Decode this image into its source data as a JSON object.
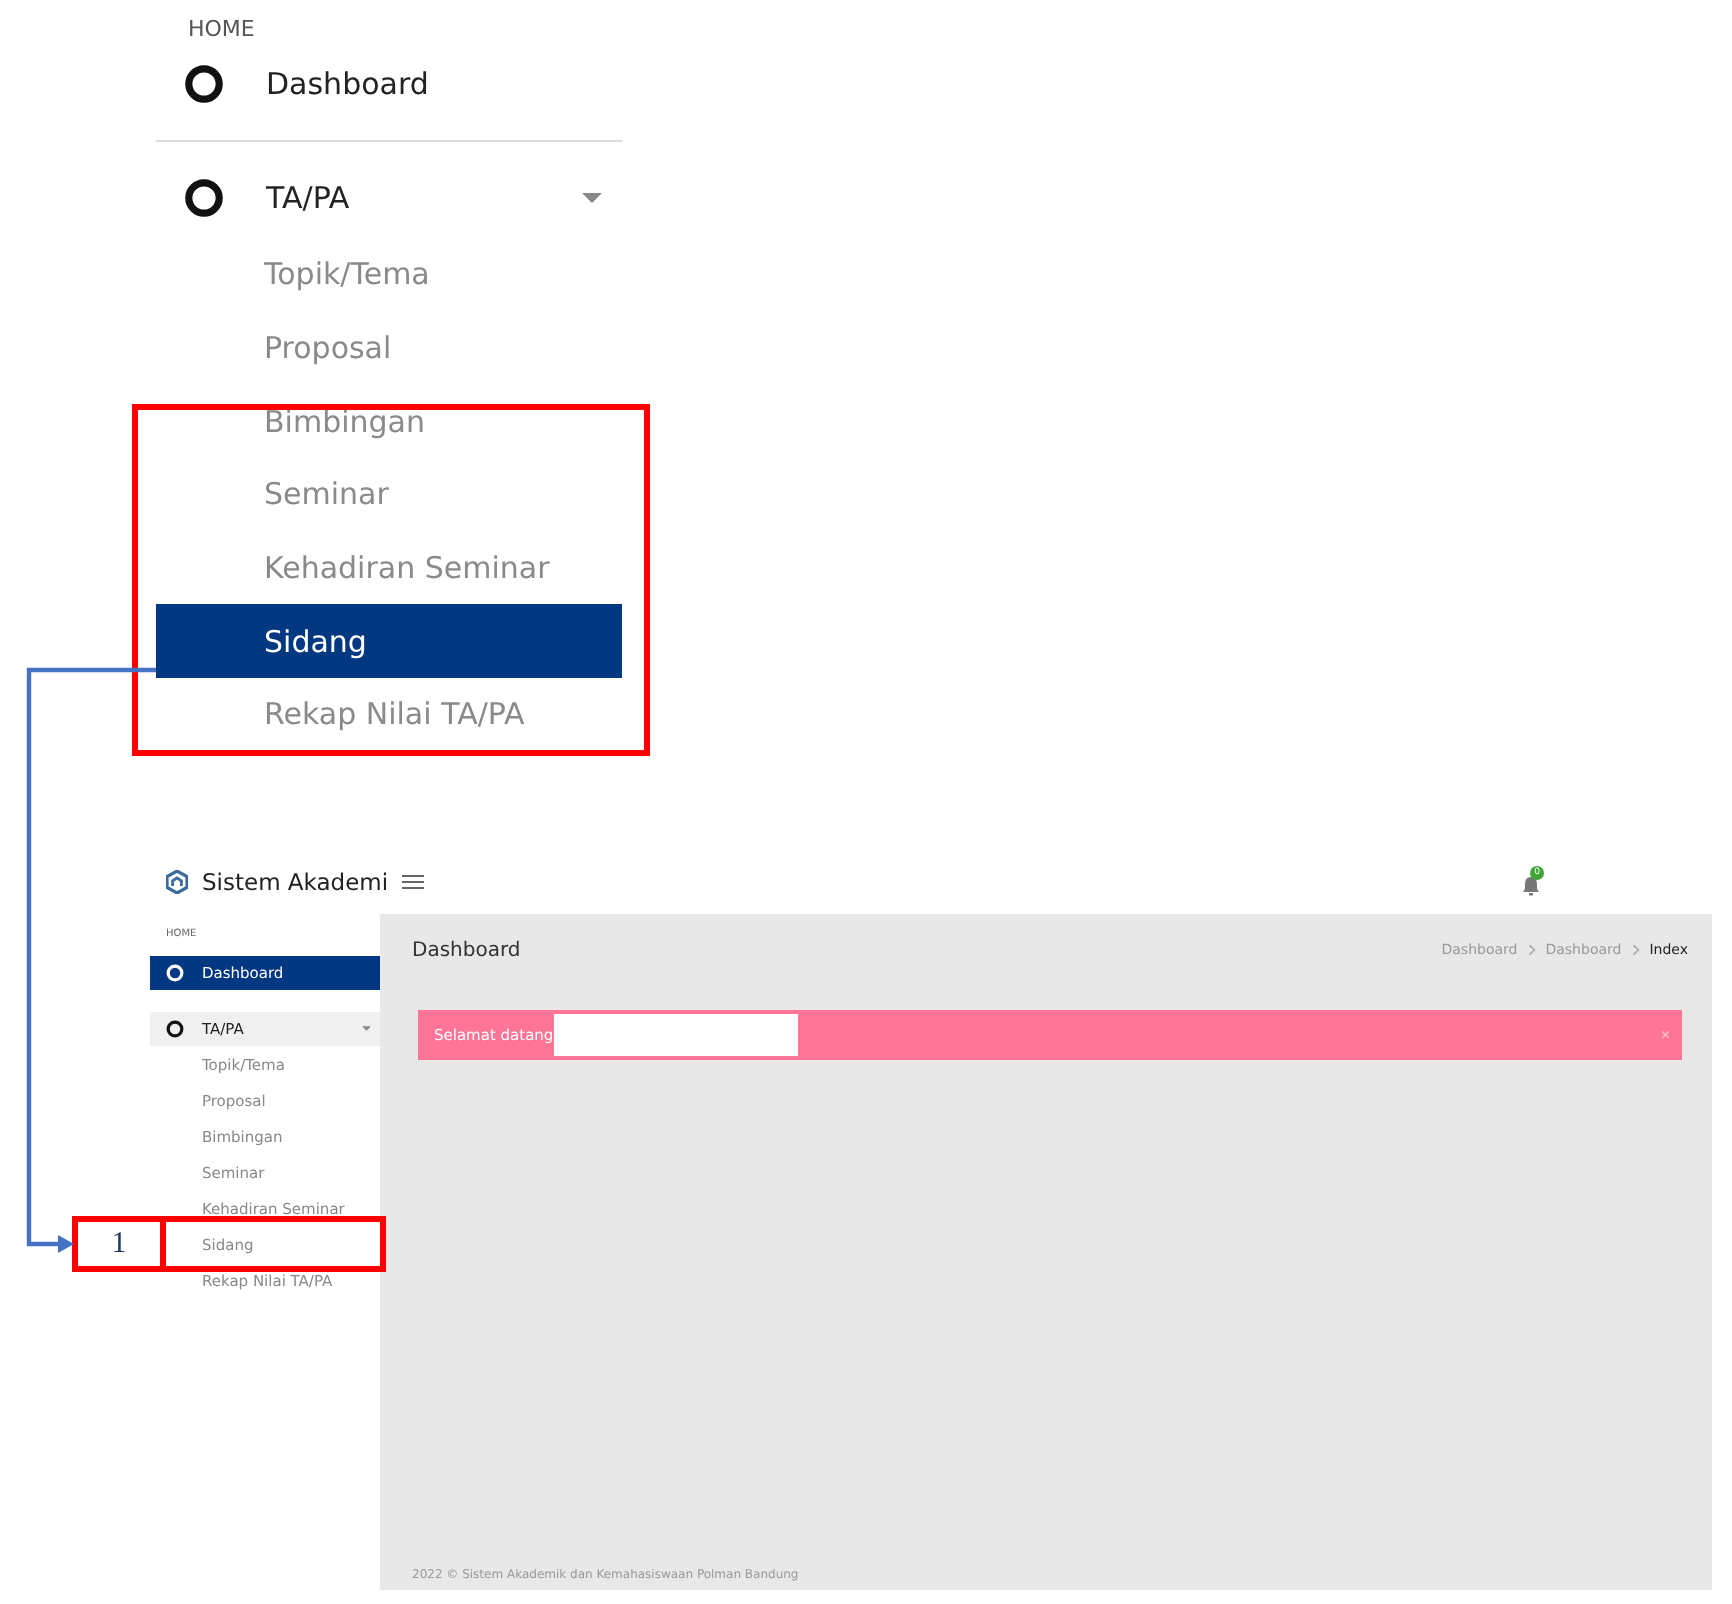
{
  "detail_view": {
    "section_label": "HOME",
    "menu": [
      {
        "kind": "link",
        "label": "Dashboard",
        "selected": false
      },
      {
        "kind": "group",
        "label": "TA/PA",
        "expanded": true,
        "highlighted": false,
        "children": [
          {
            "label": "Topik/Tema",
            "selected": false
          },
          {
            "label": "Proposal",
            "selected": false
          },
          {
            "label": "Bimbingan",
            "selected": false
          },
          {
            "label": "Seminar",
            "selected": false
          },
          {
            "label": "Kehadiran Seminar",
            "selected": false
          },
          {
            "label": "Sidang",
            "selected": true
          },
          {
            "label": "Rekap Nilai TA/PA",
            "selected": false
          }
        ]
      }
    ]
  },
  "app": {
    "title": "Sistem Akademi",
    "notification_count": "0",
    "sidebar": {
      "section_label": "HOME",
      "menu": [
        {
          "kind": "link",
          "label": "Dashboard",
          "selected": true
        },
        {
          "kind": "group",
          "label": "TA/PA",
          "expanded": true,
          "highlighted": true,
          "children": [
            {
              "label": "Topik/Tema",
              "selected": false
            },
            {
              "label": "Proposal",
              "selected": false
            },
            {
              "label": "Bimbingan",
              "selected": false
            },
            {
              "label": "Seminar",
              "selected": false
            },
            {
              "label": "Kehadiran Seminar",
              "selected": false
            },
            {
              "label": "Sidang",
              "selected": false
            },
            {
              "label": "Rekap Nilai TA/PA",
              "selected": false
            }
          ]
        }
      ]
    },
    "page_title": "Dashboard",
    "breadcrumb": [
      {
        "label": "Dashboard",
        "current": false
      },
      {
        "label": "Dashboard",
        "current": false
      },
      {
        "label": "Index",
        "current": true
      }
    ],
    "alert": {
      "message": "Selamat datang",
      "close": "×"
    },
    "footer": "2022 © Sistem Akademik dan Kemahasiswaan Polman Bandung"
  },
  "annotations": [
    {
      "label": "1"
    }
  ]
}
